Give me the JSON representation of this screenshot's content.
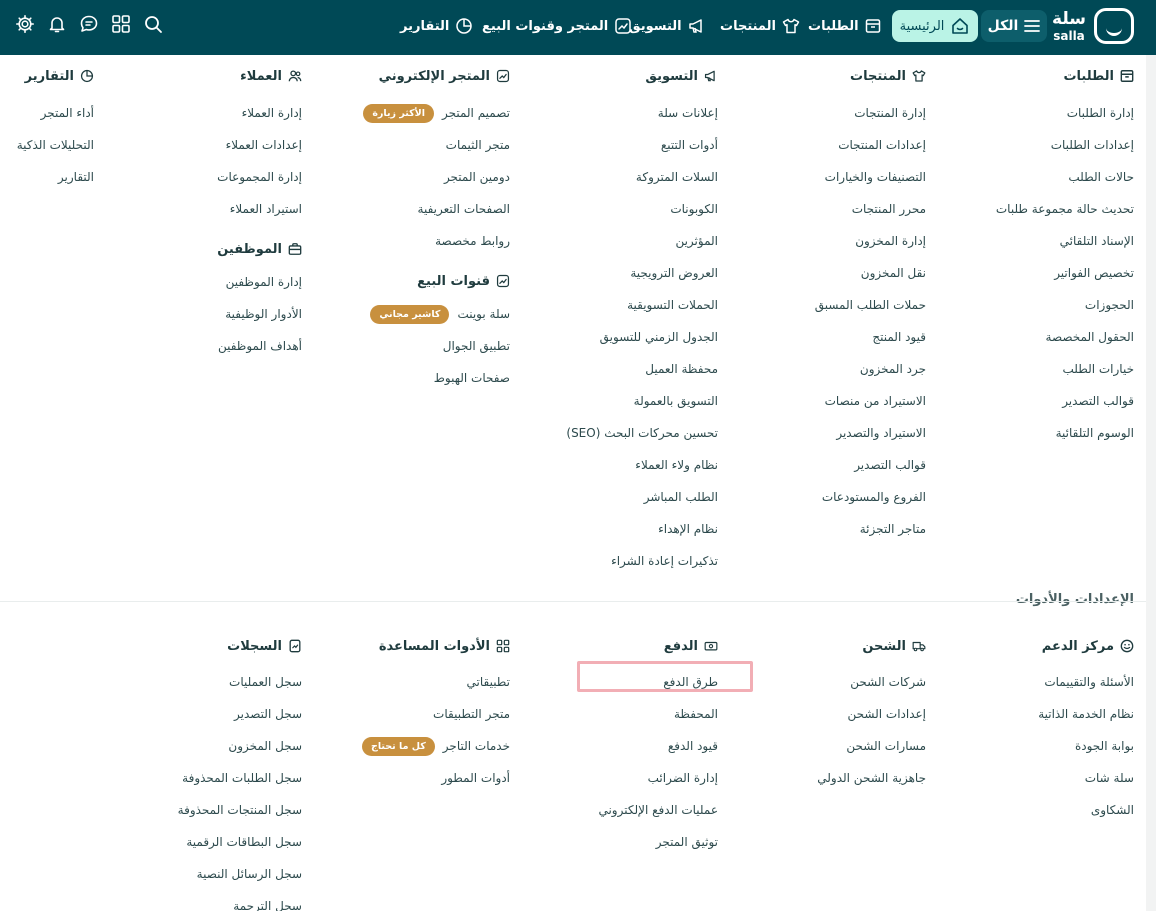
{
  "brand": {
    "name_ar": "سلة",
    "name_en": "salla"
  },
  "topnav": {
    "all": "الكل",
    "home": "الرئيسية",
    "orders": "الطلبات",
    "products": "المنتجات",
    "marketing": "التسويق",
    "store_channels": "المتجر وقنوات البيع",
    "reports": "التقارير"
  },
  "columns": {
    "orders": {
      "title": "الطلبات",
      "items": [
        "إدارة الطلبات",
        "إعدادات الطلبات",
        "حالات الطلب",
        "تحديث حالة مجموعة طلبات",
        "الإسناد التلقائي",
        "تخصيص الفواتير",
        "الحجوزات",
        "الحقول المخصصة",
        "خيارات الطلب",
        "قوالب التصدير",
        "الوسوم التلقائية"
      ]
    },
    "products": {
      "title": "المنتجات",
      "items": [
        "إدارة المنتجات",
        "إعدادات المنتجات",
        "التصنيفات والخيارات",
        "محرر المنتجات",
        "إدارة المخزون",
        "نقل المخزون",
        "حملات الطلب المسبق",
        "قيود المنتج",
        "جرد المخزون",
        "الاستيراد من منصات",
        "الاستيراد والتصدير",
        "قوالب التصدير",
        "الفروع والمستودعات",
        "متاجر التجزئة"
      ]
    },
    "marketing": {
      "title": "التسويق",
      "items": [
        "إعلانات سلة",
        "أدوات التتبع",
        "السلات المتروكة",
        "الكوبونات",
        "المؤثرين",
        "العروض الترويجية",
        "الحملات التسويقية",
        "الجدول الزمني للتسويق",
        "محفظة العميل",
        "التسويق بالعمولة",
        "تحسين محركات البحث (SEO)",
        "نظام ولاء العملاء",
        "الطلب المباشر",
        "نظام الإهداء",
        "تذكيرات إعادة الشراء"
      ]
    },
    "store": {
      "title": "المتجر الإلكتروني",
      "items": [
        {
          "label": "تصميم المتجر",
          "badge": "الأكثر زيارة"
        },
        {
          "label": "متجر الثيمات"
        },
        {
          "label": "دومين المتجر"
        },
        {
          "label": "الصفحات التعريفية"
        },
        {
          "label": "روابط مخصصة"
        }
      ]
    },
    "channels": {
      "title": "قنوات البيع",
      "items": [
        {
          "label": "سلة بوينت",
          "badge": "كاشير مجاني"
        },
        {
          "label": "تطبيق الجوال"
        },
        {
          "label": "صفحات الهبوط"
        }
      ]
    },
    "customers": {
      "title": "العملاء",
      "items": [
        "إدارة العملاء",
        "إعدادات العملاء",
        "إدارة المجموعات",
        "استيراد العملاء"
      ]
    },
    "employees": {
      "title": "الموظفين",
      "items": [
        "إدارة الموظفين",
        "الأدوار الوظيفية",
        "أهداف الموظفين"
      ]
    },
    "reports": {
      "title": "التقارير",
      "items": [
        "أداء المتجر",
        "التحليلات الذكية",
        "التقارير"
      ]
    }
  },
  "settings": {
    "title": "الإعدادات والأدوات",
    "support": {
      "title": "مركز الدعم",
      "items": [
        "الأسئلة والتقييمات",
        "نظام الخدمة الذاتية",
        "بوابة الجودة",
        "سلة شات",
        "الشكاوى"
      ]
    },
    "shipping": {
      "title": "الشحن",
      "items": [
        "شركات الشحن",
        "إعدادات الشحن",
        "مسارات الشحن",
        "جاهزية الشحن الدولي"
      ]
    },
    "payment": {
      "title": "الدفع",
      "items": [
        "طرق الدفع",
        "المحفظة",
        "قيود الدفع",
        "إدارة الضرائب",
        "عمليات الدفع الإلكتروني",
        "توثيق المتجر"
      ]
    },
    "tools": {
      "title": "الأدوات المساعدة",
      "items": [
        {
          "label": "تطبيقاتي"
        },
        {
          "label": "متجر التطبيقات"
        },
        {
          "label": "خدمات التاجر",
          "badge": "كل ما تحتاج"
        },
        {
          "label": "أدوات المطور"
        }
      ]
    },
    "logs": {
      "title": "السجلات",
      "items": [
        "سجل العمليات",
        "سجل التصدير",
        "سجل المخزون",
        "سجل الطلبات المحذوفة",
        "سجل المنتجات المحذوفة",
        "سجل البطاقات الرقمية",
        "سجل الرسائل النصية",
        "سجل الترجمة"
      ]
    }
  },
  "colors": {
    "topbar": "#004956",
    "home_pill": "#baf3e6",
    "badge": "#c8903e",
    "highlight": "#f2aeb5"
  }
}
